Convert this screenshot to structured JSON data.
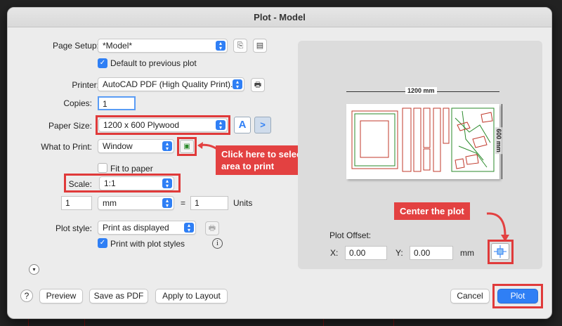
{
  "window": {
    "title": "Plot - Model"
  },
  "page_setup": {
    "label": "Page Setup:",
    "value": "*Model*",
    "default_checkbox_label": "Default to previous plot"
  },
  "printer": {
    "label": "Printer:",
    "value": "AutoCAD PDF (High Quality Print)...."
  },
  "copies": {
    "label": "Copies:",
    "value": "1"
  },
  "paper_size": {
    "label": "Paper Size:",
    "value": "1200 x 600 Plywood"
  },
  "what_to_print": {
    "label": "What to Print:",
    "value": "Window"
  },
  "fit_to_paper": {
    "label": "Fit to paper"
  },
  "scale": {
    "label": "Scale:",
    "value": "1:1",
    "left_value": "1",
    "unit": "mm",
    "equals": "=",
    "right_value": "1",
    "units_label": "Units"
  },
  "plot_style": {
    "label": "Plot style:",
    "value": "Print as displayed",
    "print_with_styles_label": "Print with plot styles"
  },
  "preview": {
    "width_dim": "1200 mm",
    "height_dim": "600 mm"
  },
  "plot_offset": {
    "label": "Plot Offset:",
    "x_label": "X:",
    "x_value": "0.00",
    "y_label": "Y:",
    "y_value": "0.00",
    "unit": "mm"
  },
  "callouts": {
    "select_area": "Click here to select area to print",
    "center_plot": "Center the plot"
  },
  "buttons": {
    "help": "?",
    "preview": "Preview",
    "save_pdf": "Save as PDF",
    "apply_layout": "Apply to Layout",
    "cancel": "Cancel",
    "plot": "Plot"
  },
  "colors": {
    "accent": "#2f7ff5",
    "callout": "#e34141"
  }
}
